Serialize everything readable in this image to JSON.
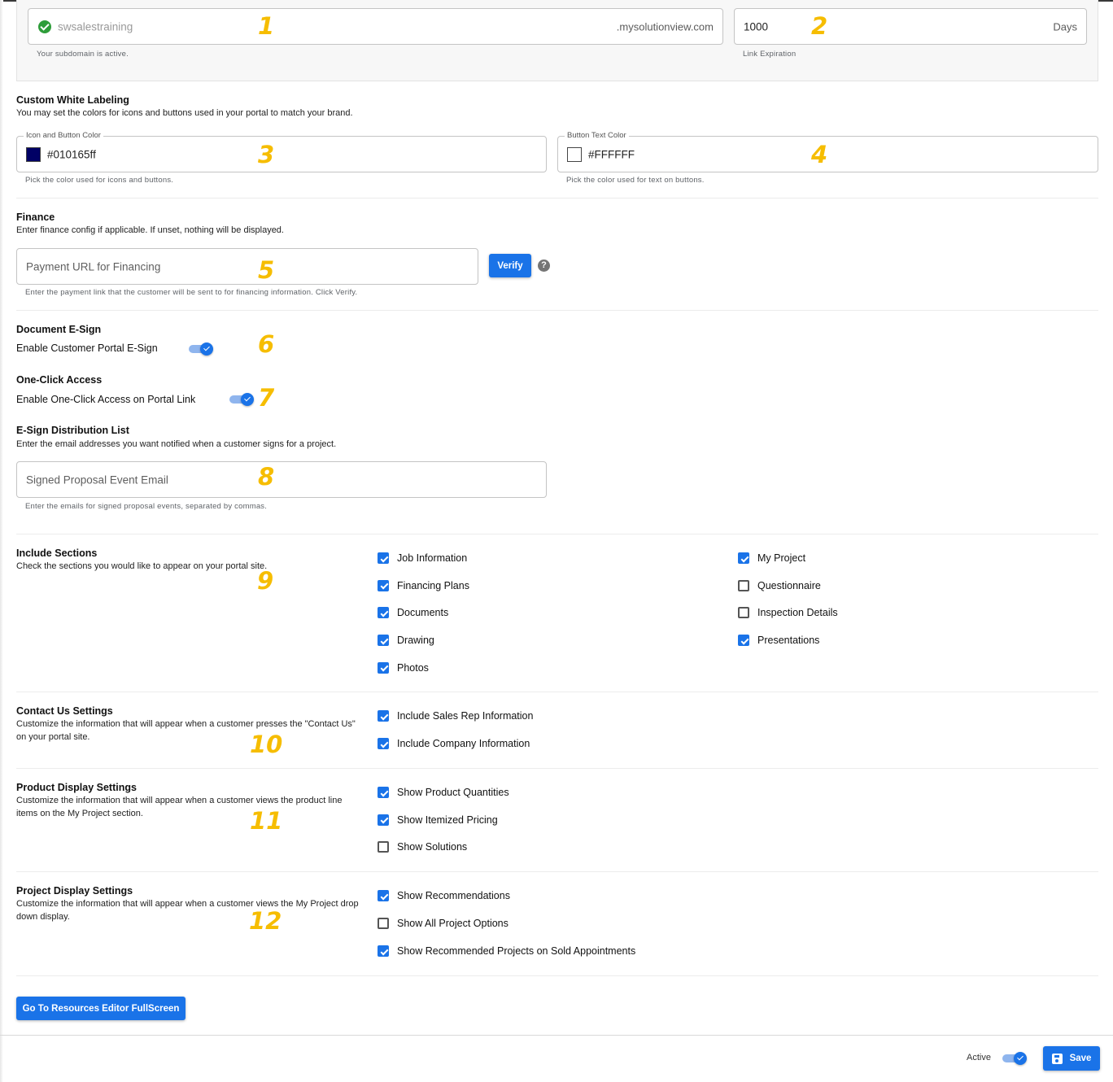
{
  "subdomain": {
    "value": "swsalestraining",
    "suffix": ".mysolutionview.com",
    "helper": "Your subdomain is active.",
    "status_icon": "check-circle-icon"
  },
  "link_expiration": {
    "value": "1000",
    "suffix": "Days",
    "helper": "Link Expiration"
  },
  "white_labeling": {
    "title": "Custom White Labeling",
    "description": "You may set the colors for icons and buttons used in your portal to match your brand.",
    "icon_color": {
      "legend": "Icon and Button Color",
      "value": "#010165ff",
      "swatch": "#010165",
      "helper": "Pick the color used for icons and buttons."
    },
    "text_color": {
      "legend": "Button Text Color",
      "value": "#FFFFFF",
      "swatch": "#FFFFFF",
      "helper": "Pick the color used for text on buttons."
    }
  },
  "finance": {
    "title": "Finance",
    "description": "Enter finance config if applicable. If unset, nothing will be displayed.",
    "placeholder": "Payment URL for Financing",
    "verify_label": "Verify",
    "help_glyph": "?",
    "helper": "Enter the payment link that the customer will be sent to for financing information. Click Verify."
  },
  "esign": {
    "title": "Document E-Sign",
    "toggle_label": "Enable Customer Portal E-Sign",
    "enabled": true
  },
  "one_click": {
    "title": "One-Click Access",
    "toggle_label": "Enable One-Click Access on Portal Link",
    "enabled": true
  },
  "distribution": {
    "title": "E-Sign Distribution List",
    "description": "Enter the email addresses you want notified when a customer signs for a project.",
    "placeholder": "Signed Proposal Event Email",
    "helper": "Enter the emails for signed proposal events, separated by commas."
  },
  "include_sections": {
    "title": "Include Sections",
    "description": "Check the sections you would like to appear on your portal site.",
    "left": [
      {
        "label": "Job Information",
        "checked": true
      },
      {
        "label": "Financing Plans",
        "checked": true
      },
      {
        "label": "Documents",
        "checked": true
      },
      {
        "label": "Drawing",
        "checked": true
      },
      {
        "label": "Photos",
        "checked": true
      }
    ],
    "right": [
      {
        "label": "My Project",
        "checked": true
      },
      {
        "label": "Questionnaire",
        "checked": false
      },
      {
        "label": "Inspection Details",
        "checked": false
      },
      {
        "label": "Presentations",
        "checked": true
      }
    ]
  },
  "contact_us": {
    "title": "Contact Us Settings",
    "description": "Customize the information that will appear when a customer presses the \"Contact Us\" on your portal site.",
    "options": [
      {
        "label": "Include Sales Rep Information",
        "checked": true
      },
      {
        "label": "Include Company Information",
        "checked": true
      }
    ]
  },
  "product_display": {
    "title": "Product Display Settings",
    "description": "Customize the information that will appear when a customer views the product line items on the My Project section.",
    "options": [
      {
        "label": "Show Product Quantities",
        "checked": true
      },
      {
        "label": "Show Itemized Pricing",
        "checked": true
      },
      {
        "label": "Show Solutions",
        "checked": false
      }
    ]
  },
  "project_display": {
    "title": "Project Display Settings",
    "description": "Customize the information that will appear when a customer views the My Project drop down display.",
    "options": [
      {
        "label": "Show Recommendations",
        "checked": true
      },
      {
        "label": "Show All Project Options",
        "checked": false
      },
      {
        "label": "Show Recommended Projects on Sold Appointments",
        "checked": true
      }
    ]
  },
  "resources_button_label": "Go To Resources Editor FullScreen",
  "footer": {
    "active_label": "Active",
    "active": true,
    "save_label": "Save",
    "save_icon": "floppy-disk-icon"
  },
  "annotations": [
    "1",
    "2",
    "3",
    "4",
    "5",
    "6",
    "7",
    "8",
    "9",
    "10",
    "11",
    "12"
  ],
  "colors": {
    "accent": "#1a73e8",
    "annotation": "#f6bd00",
    "success": "#2e9d3a"
  }
}
